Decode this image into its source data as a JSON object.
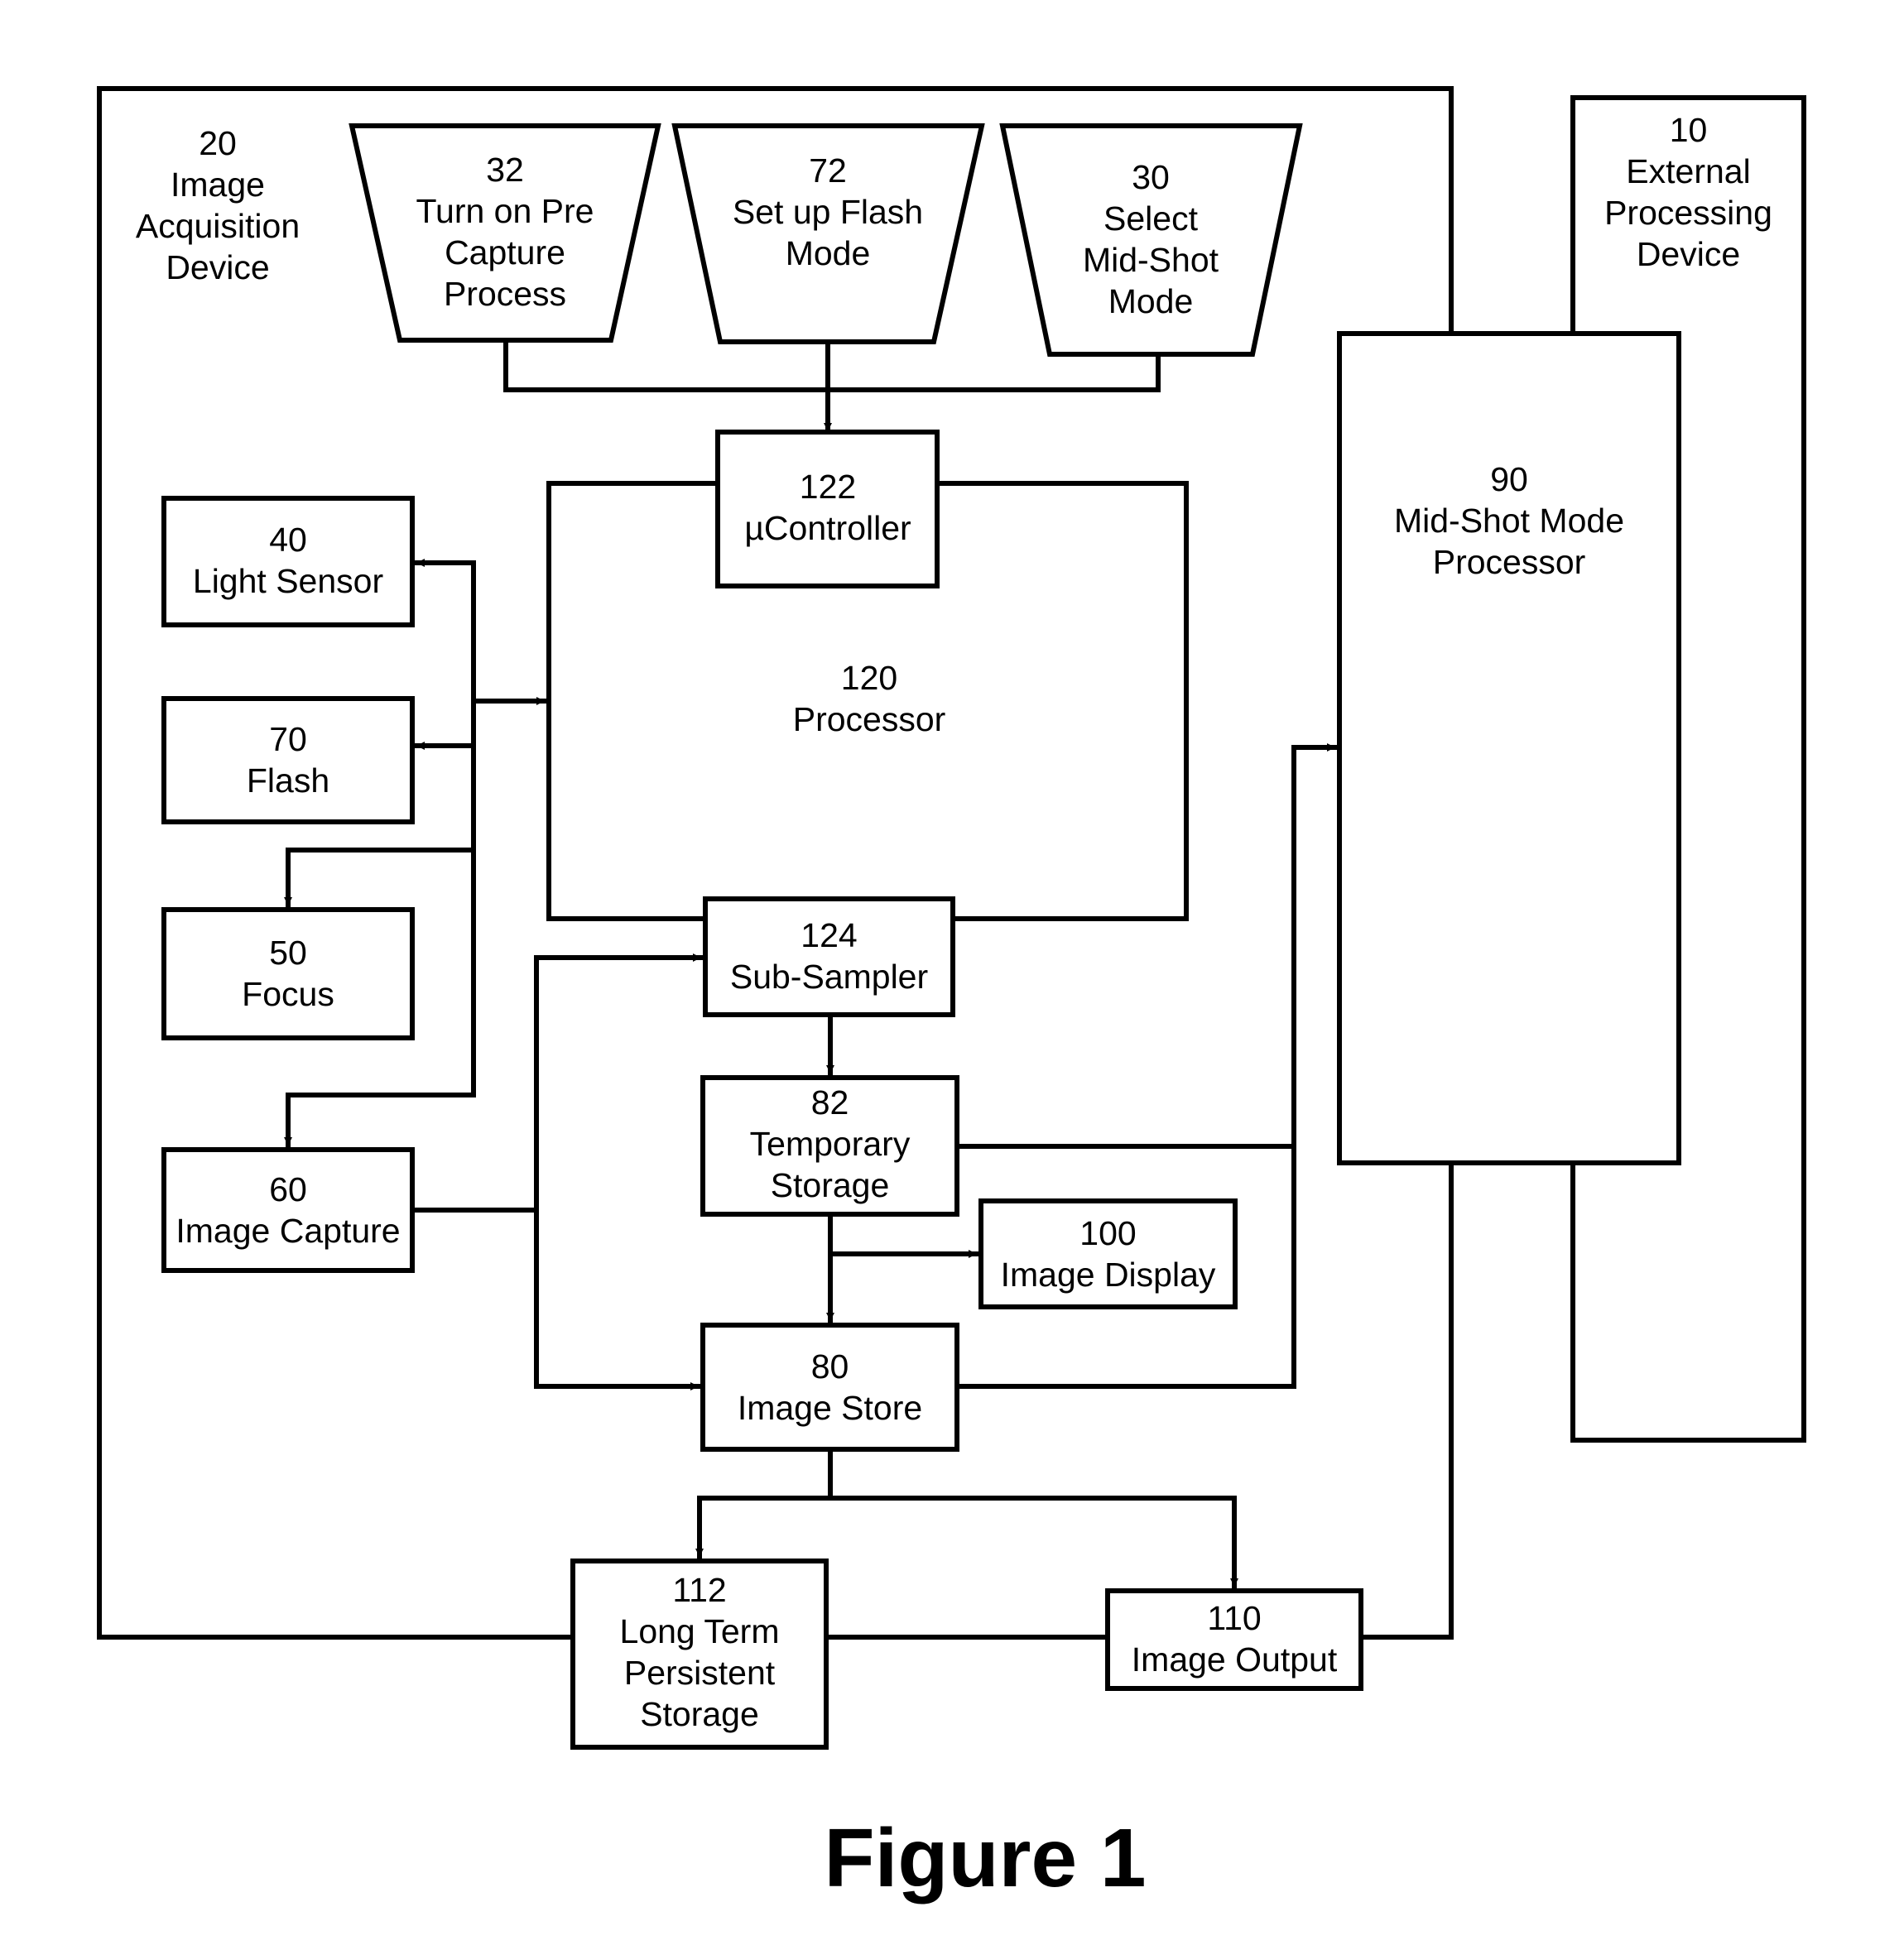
{
  "figure": {
    "caption": "Figure 1",
    "colors": {
      "stroke": "#000000",
      "background": "#ffffff"
    }
  },
  "blocks": {
    "image_acquisition_device": {
      "number": "20",
      "lines": [
        "Image",
        "Acquisition",
        "Device"
      ]
    },
    "external_processing_device": {
      "number": "10",
      "lines": [
        "External",
        "Processing",
        "Device"
      ]
    },
    "pre_capture": {
      "number": "32",
      "lines": [
        "Turn on Pre",
        "Capture",
        "Process"
      ]
    },
    "flash_mode": {
      "number": "72",
      "lines": [
        "Set up Flash",
        "Mode"
      ]
    },
    "mid_shot_select": {
      "number": "30",
      "lines": [
        "Select",
        "Mid-Shot",
        "Mode"
      ]
    },
    "ucontroller": {
      "number": "122",
      "lines": [
        "µController"
      ]
    },
    "processor": {
      "number": "120",
      "lines": [
        "Processor"
      ]
    },
    "mid_shot_processor": {
      "number": "90",
      "lines": [
        "Mid-Shot Mode",
        "Processor"
      ]
    },
    "light_sensor": {
      "number": "40",
      "lines": [
        "Light Sensor"
      ]
    },
    "flash": {
      "number": "70",
      "lines": [
        "Flash"
      ]
    },
    "focus": {
      "number": "50",
      "lines": [
        "Focus"
      ]
    },
    "image_capture": {
      "number": "60",
      "lines": [
        "Image Capture"
      ]
    },
    "sub_sampler": {
      "number": "124",
      "lines": [
        "Sub-Sampler"
      ]
    },
    "temporary_storage": {
      "number": "82",
      "lines": [
        "Temporary",
        "Storage"
      ]
    },
    "image_display": {
      "number": "100",
      "lines": [
        "Image Display"
      ]
    },
    "image_store": {
      "number": "80",
      "lines": [
        "Image Store"
      ]
    },
    "long_term_storage": {
      "number": "112",
      "lines": [
        "Long Term",
        "Persistent",
        "Storage"
      ]
    },
    "image_output": {
      "number": "110",
      "lines": [
        "Image Output"
      ]
    }
  },
  "connections": [
    {
      "from": "pre_capture",
      "to": "ucontroller"
    },
    {
      "from": "flash_mode",
      "to": "ucontroller"
    },
    {
      "from": "mid_shot_select",
      "to": "ucontroller"
    },
    {
      "from": "processor",
      "to": "light_sensor"
    },
    {
      "from": "processor",
      "to": "flash"
    },
    {
      "from": "processor",
      "to": "focus"
    },
    {
      "from": "processor",
      "to": "image_capture"
    },
    {
      "from": "light_sensor",
      "to": "processor"
    },
    {
      "from": "image_capture",
      "to": "sub_sampler"
    },
    {
      "from": "image_capture",
      "to": "image_store"
    },
    {
      "from": "sub_sampler",
      "to": "temporary_storage"
    },
    {
      "from": "temporary_storage",
      "to": "image_display"
    },
    {
      "from": "temporary_storage",
      "to": "image_store"
    },
    {
      "from": "temporary_storage",
      "to": "mid_shot_processor"
    },
    {
      "from": "image_store",
      "to": "mid_shot_processor"
    },
    {
      "from": "image_store",
      "to": "long_term_storage"
    },
    {
      "from": "image_store",
      "to": "image_output"
    }
  ]
}
